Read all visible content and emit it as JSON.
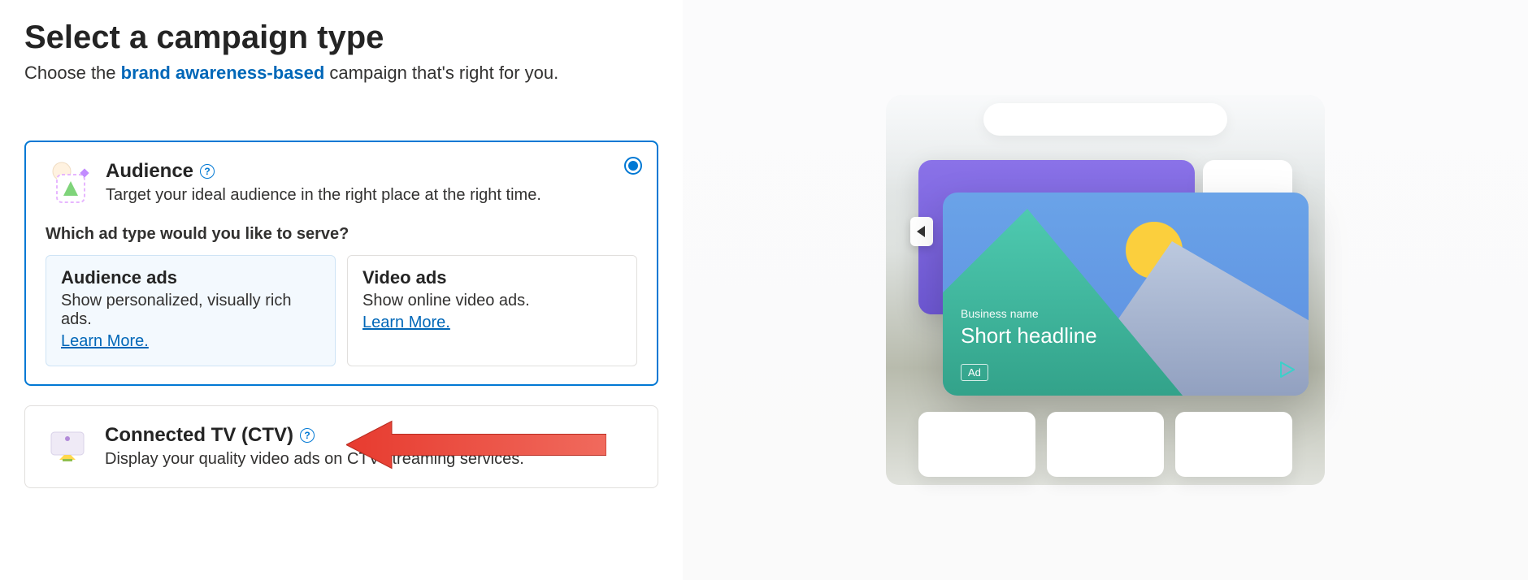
{
  "header": {
    "title": "Select a campaign type",
    "subtitle_prefix": "Choose the ",
    "subtitle_highlight": "brand awareness-based",
    "subtitle_suffix": " campaign that's right for you."
  },
  "cards": {
    "audience": {
      "title": "Audience",
      "desc": "Target your ideal audience in the right place at the right time.",
      "question": "Which ad type would you like to serve?",
      "selected": true,
      "options": [
        {
          "title": "Audience ads",
          "desc": "Show personalized, visually rich ads.",
          "learn_more": "Learn More.",
          "selected": true
        },
        {
          "title": "Video ads",
          "desc": "Show online video ads.",
          "learn_more": "Learn More.",
          "selected": false
        }
      ]
    },
    "ctv": {
      "title": "Connected TV (CTV)",
      "desc": "Display your quality video ads on CTV streaming services."
    }
  },
  "preview": {
    "business_name": "Business name",
    "headline": "Short headline",
    "ad_badge": "Ad"
  },
  "help_glyph": "?"
}
